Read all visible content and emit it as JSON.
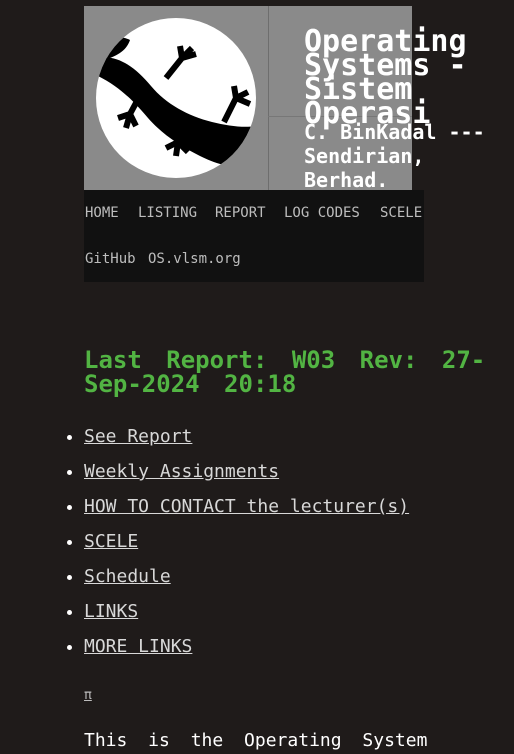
{
  "header": {
    "title": "Operating Systems - Sistem Operasi",
    "subtitle": "C. BinKadal --- Sendirian, Berhad."
  },
  "nav": {
    "items": [
      "HOME",
      "LISTING",
      "REPORT",
      "LOG CODES",
      "SCELE"
    ],
    "items2": [
      "GitHub",
      "OS.vlsm.org"
    ]
  },
  "report": {
    "heading": "Last Report: W03 Rev: 27-Sep-2024 20:18"
  },
  "links": [
    "See Report",
    "Weekly Assignments",
    "HOW TO CONTACT the lecturer(s)",
    "SCELE",
    "Schedule",
    "LINKS",
    "MORE LINKS"
  ],
  "pi": "π",
  "intro": "This is the Operating System"
}
